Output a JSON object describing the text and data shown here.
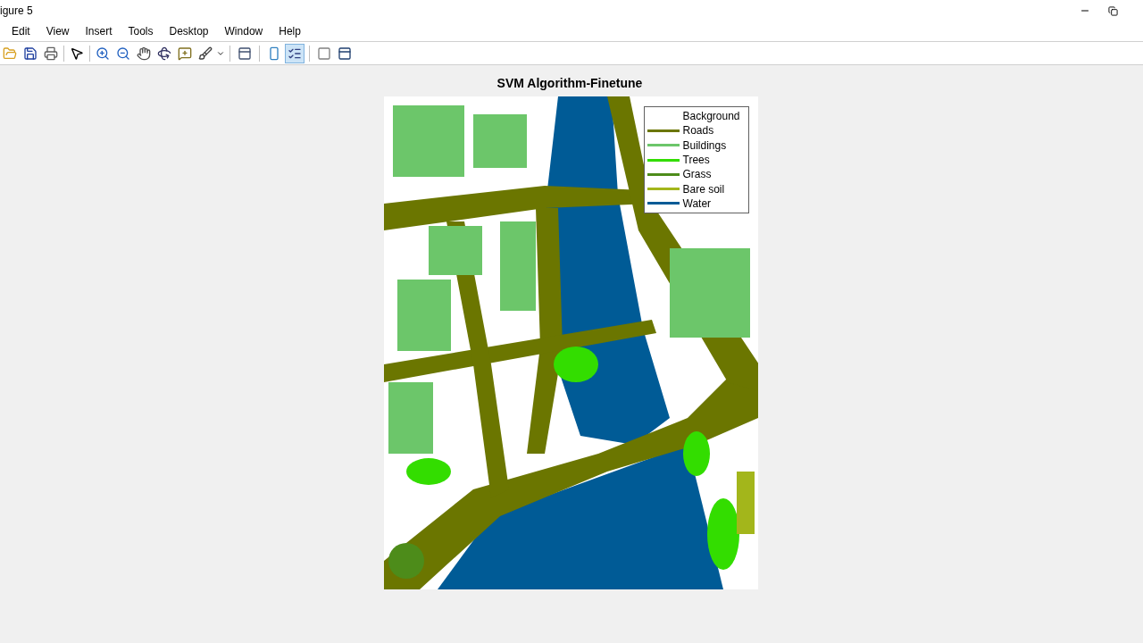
{
  "window": {
    "title": "igure 5"
  },
  "menu": [
    "Edit",
    "View",
    "Insert",
    "Tools",
    "Desktop",
    "Window",
    "Help"
  ],
  "toolbar": {
    "legend_toggle": {
      "selected": true
    }
  },
  "figure": {
    "title": "SVM Algorithm-Finetune",
    "legend": [
      {
        "label": "Background"
      },
      {
        "label": "Roads",
        "color": "#6b7600"
      },
      {
        "label": "Buildings",
        "color": "#6cc66a"
      },
      {
        "label": "Trees",
        "color": "#33dd00"
      },
      {
        "label": "Grass",
        "color": "#4d8c1a"
      },
      {
        "label": "Bare soil",
        "color": "#a3b61b"
      },
      {
        "label": "Water",
        "color": "#005b96"
      }
    ]
  }
}
